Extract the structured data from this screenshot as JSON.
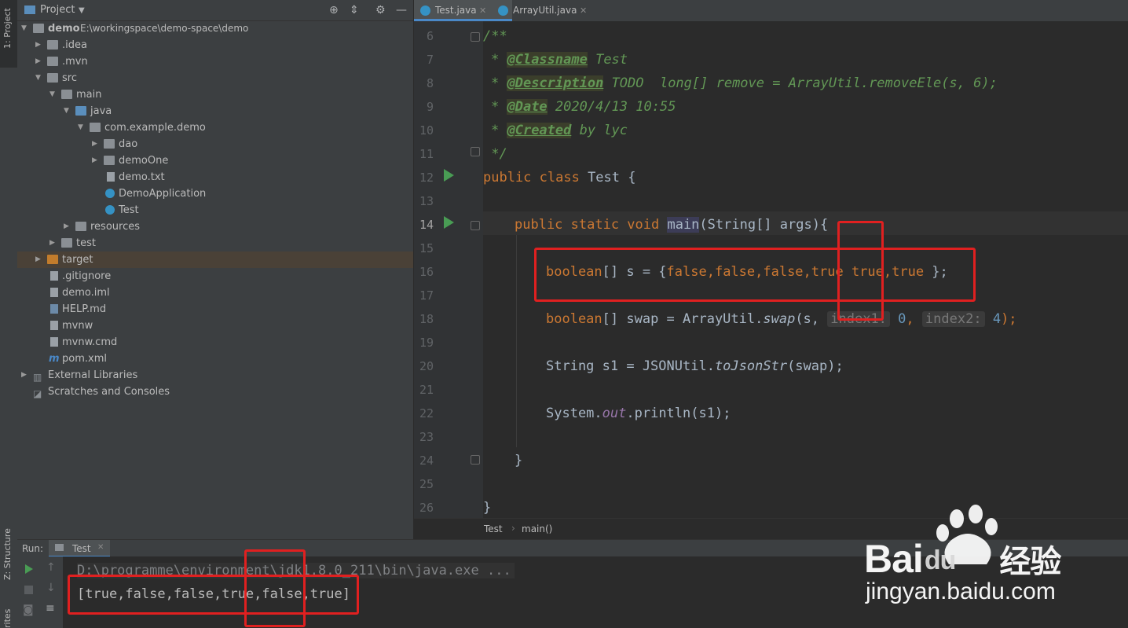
{
  "toolstrip": {
    "project_tab": "1: Project",
    "structure_tab": "Z: Structure",
    "favorites_tab": "rites"
  },
  "project": {
    "title": "Project",
    "tree": [
      {
        "label": "demo",
        "path": "E:\\workingspace\\demo-space\\demo"
      },
      {
        "label": ".idea"
      },
      {
        "label": ".mvn"
      },
      {
        "label": "src"
      },
      {
        "label": "main"
      },
      {
        "label": "java"
      },
      {
        "label": "com.example.demo"
      },
      {
        "label": "dao"
      },
      {
        "label": "demoOne"
      },
      {
        "label": "demo.txt"
      },
      {
        "label": "DemoApplication"
      },
      {
        "label": "Test"
      },
      {
        "label": "resources"
      },
      {
        "label": "test"
      },
      {
        "label": "target"
      },
      {
        "label": ".gitignore"
      },
      {
        "label": "demo.iml"
      },
      {
        "label": "HELP.md"
      },
      {
        "label": "mvnw"
      },
      {
        "label": "mvnw.cmd"
      },
      {
        "label": "pom.xml"
      },
      {
        "label": "External Libraries"
      },
      {
        "label": "Scratches and Consoles"
      }
    ]
  },
  "tabs": [
    {
      "label": "Test.java"
    },
    {
      "label": "ArrayUtil.java"
    }
  ],
  "editor": {
    "line_numbers": [
      "6",
      "7",
      "8",
      "9",
      "10",
      "11",
      "12",
      "13",
      "14",
      "15",
      "16",
      "17",
      "18",
      "19",
      "20",
      "21",
      "22",
      "23",
      "24",
      "25",
      "26"
    ],
    "comment_open": "/**",
    "classname_tag": "@Classname",
    "classname_val": " Test",
    "description_tag": "@Description",
    "description_val": " TODO  long[] remove = ArrayUtil.removeEle(s, 6);",
    "date_tag": "@Date",
    "date_val": " 2020/4/13 10:55",
    "created_tag": "@Created",
    "created_val": " by lyc",
    "comment_close": " */",
    "class_kw": "public class ",
    "class_name": "Test {",
    "main_kw": "public static void ",
    "main_name": "main",
    "main_args": "(String[] args){",
    "line16_kw": "boolean",
    "line16_rest": "[] s = {",
    "line16_values": "false,false,false,true true,true",
    "line16_end": " };",
    "line18_kw": "boolean",
    "line18_rest": "[] swap = ArrayUtil.",
    "line18_method": "swap",
    "line18_arg": "(s, ",
    "hint1": "index1:",
    "hint1_val": "0",
    "hint2": "index2:",
    "hint2_val": "4",
    "line18_end": ");",
    "line20": "String s1 = JSONUtil.",
    "line20_method": "toJsonStr",
    "line20_end": "(swap);",
    "line22": "System.",
    "line22_field": "out",
    "line22_end": ".println(s1);",
    "close_brace1": "}",
    "close_brace2": "}"
  },
  "breadcrumb": {
    "class": "Test",
    "sep": "›",
    "method": "main()"
  },
  "run": {
    "label": "Run:",
    "tab": "Test",
    "cmd_line": "D:\\programme\\environment\\jdk1.8.0_211\\bin\\java.exe ...",
    "output": "[true,false,false,true,false,true]"
  },
  "watermark": {
    "brand": "Bai",
    "brand2": "du",
    "suffix": "经验",
    "url": "jingyan.baidu.com"
  },
  "colors": {
    "annotation_red": "#e02020",
    "run_green": "#499c54",
    "keyword": "#cc7832"
  }
}
